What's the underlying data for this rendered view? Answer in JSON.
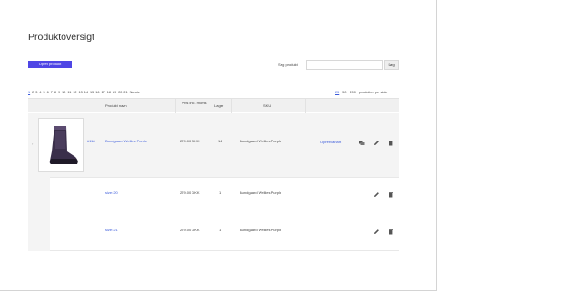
{
  "page": {
    "title": "Produktoversigt"
  },
  "toolbar": {
    "create_label": "Opret produkt",
    "search_label": "Søg produkt",
    "search_placeholder": "",
    "search_button": "Søg"
  },
  "pagination": {
    "pages": [
      "1",
      "2",
      "3",
      "4",
      "5",
      "6",
      "7",
      "8",
      "9",
      "10",
      "11",
      "12",
      "13",
      "14",
      "15",
      "16",
      "17",
      "18",
      "19",
      "20",
      "21"
    ],
    "current": "1",
    "next_label": "Næste"
  },
  "per_page": {
    "options": [
      "25",
      "50",
      "200"
    ],
    "active": "25",
    "suffix": "produkter per side"
  },
  "table": {
    "headers": {
      "name": "Produkt navn",
      "price": "Pris inkl. moms",
      "stock": "Lager",
      "sku": "SKU"
    },
    "product": {
      "id": "#118",
      "name": "Bundgaard Wellies Purple",
      "price": "279.00 DKK",
      "stock": "14",
      "sku": "Bundgaard Wellies Purple",
      "variant_link": "Opret variant"
    },
    "variants": [
      {
        "name": "size: 20",
        "price": "279.00 DKK",
        "stock": "1",
        "sku": "Bundgaard Wellies Purple"
      },
      {
        "name": "size: 21",
        "price": "279.00 DKK",
        "stock": "1",
        "sku": "Bundgaard Wellies Purple"
      }
    ]
  },
  "icons": {
    "expand": "chevron-right-icon",
    "copy": "copy-icon",
    "edit": "pencil-icon",
    "delete": "trash-icon"
  },
  "colors": {
    "accent": "#4f46e5",
    "link": "#3b5bdb"
  }
}
